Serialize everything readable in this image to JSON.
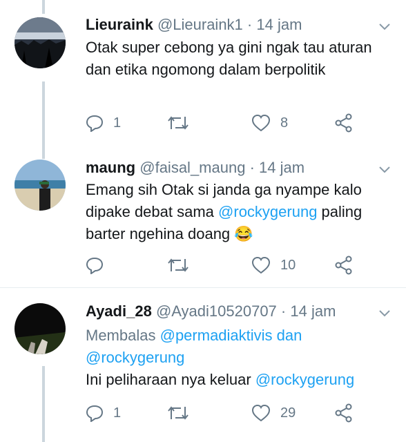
{
  "tweets": [
    {
      "name": "Lieuraink",
      "handle": "@Lieuraink1",
      "sep": "·",
      "time": "14 jam",
      "text": "Otak super cebong ya gini ngak tau aturan dan etika ngomong dalam berpolitik",
      "replies": "1",
      "retweets": "",
      "likes": "8"
    },
    {
      "name": "maung",
      "handle": "@faisal_maung",
      "sep": "·",
      "time": "14 jam",
      "text_before": "Emang sih Otak si janda ga nyampe kalo dipake debat sama ",
      "mention": "@rockygerung",
      "text_after": " paling barter ngehina doang ",
      "emoji": "😂",
      "replies": "",
      "retweets": "",
      "likes": "10"
    },
    {
      "name": "Ayadi_28",
      "handle": "@Ayadi10520707",
      "sep": "·",
      "time": "14 jam",
      "reply_prefix": "Membalas",
      "reply_mention_1": "@permadiaktivis",
      "reply_and": "dan",
      "reply_mention_2": "@rockygerung",
      "text_before": "Ini peliharaan nya keluar ",
      "mention": "@rockygerung",
      "replies": "1",
      "retweets": "",
      "likes": "29"
    }
  ],
  "colors": {
    "accent": "#1da1f2",
    "muted": "#657786",
    "thread": "#ccd6dd"
  },
  "icons": [
    "reply-icon",
    "retweet-icon",
    "like-icon",
    "share-icon",
    "chevron-down-icon"
  ]
}
